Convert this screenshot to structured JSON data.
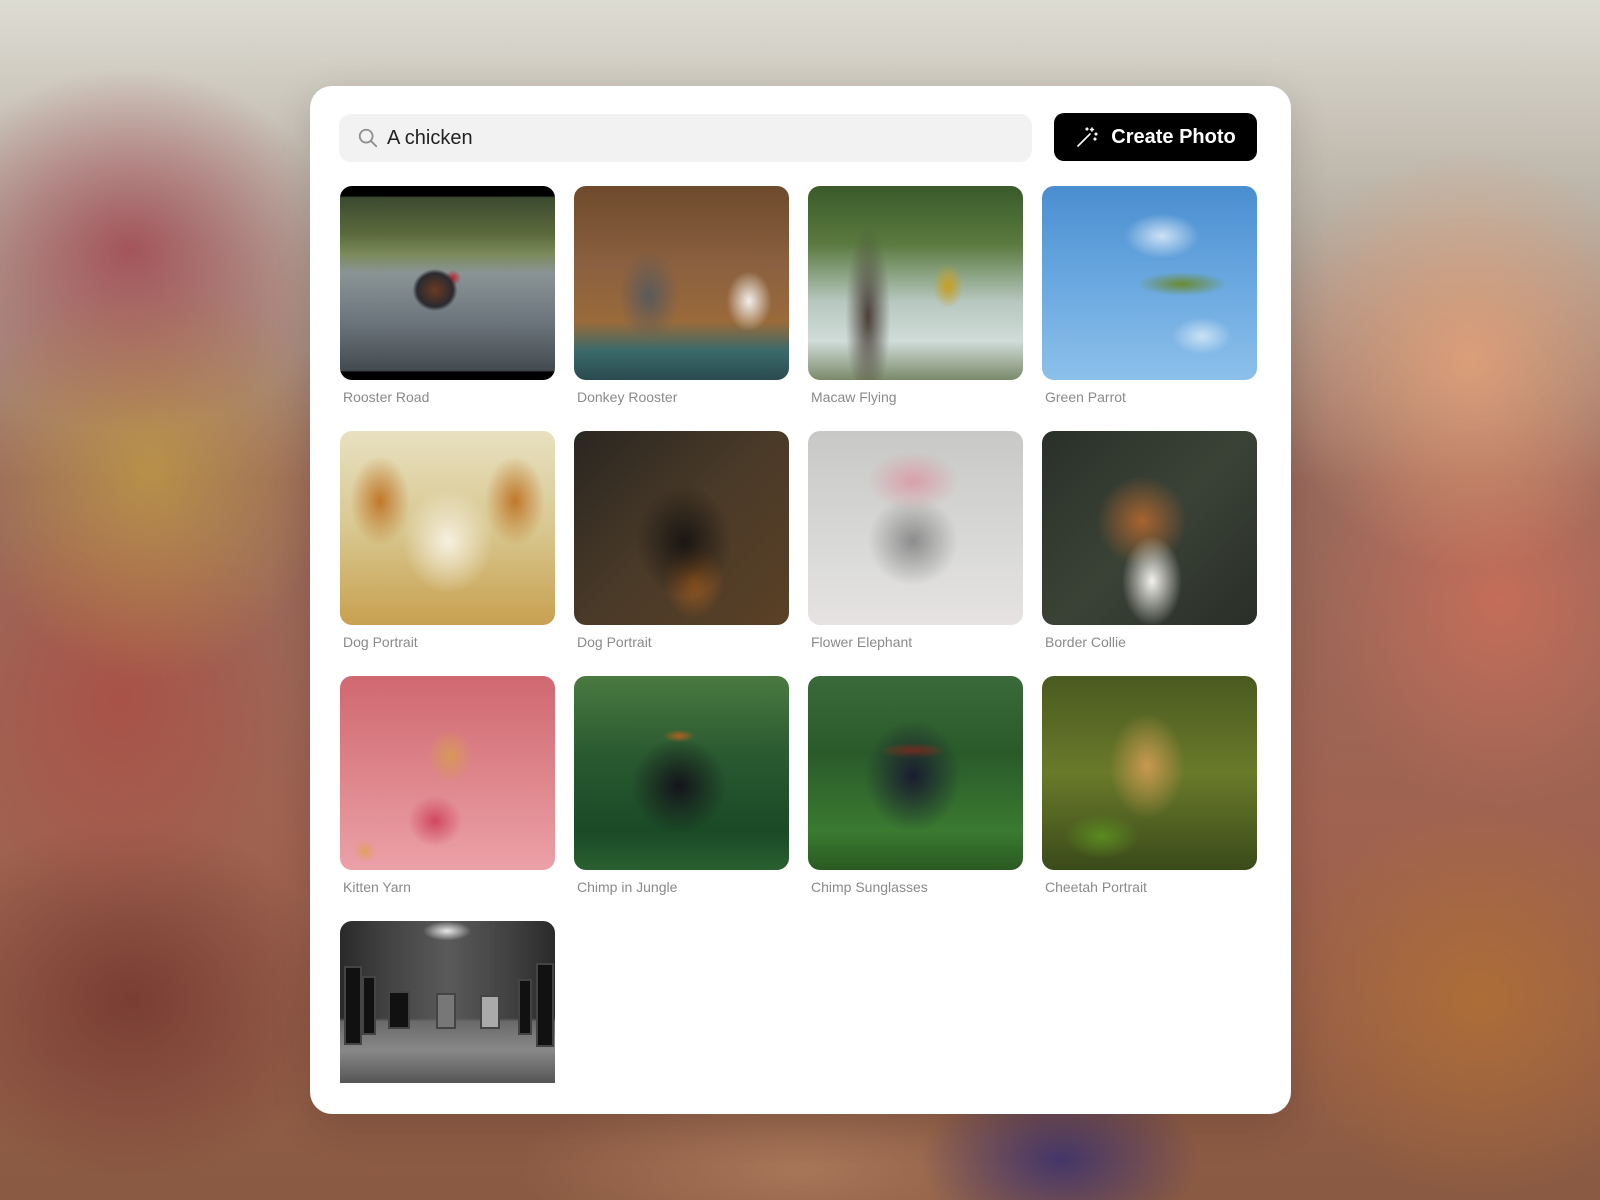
{
  "search": {
    "value": "A chicken",
    "icon": "search-icon"
  },
  "toolbar": {
    "create_label": "Create Photo",
    "create_icon": "magic-wand-icon",
    "create_bg": "#000000"
  },
  "gallery": {
    "items": [
      {
        "label": "Rooster Road",
        "image": "rooster crossing a wet forest road"
      },
      {
        "label": "Donkey Rooster",
        "image": "donkey and white rooster on a boat by a cabin"
      },
      {
        "label": "Macaw Flying",
        "image": "macaw flying by a large tree"
      },
      {
        "label": "Green Parrot",
        "image": "green parrot flying in blue sky"
      },
      {
        "label": "Dog Portrait",
        "image": "painted portrait of a fluffy dog"
      },
      {
        "label": "Dog Portrait",
        "image": "black and tan dog portrait"
      },
      {
        "label": "Flower Elephant",
        "image": "elephant covered in flowers"
      },
      {
        "label": "Border Collie",
        "image": "brown and white border collie"
      },
      {
        "label": "Kitten Yarn",
        "image": "kitten playing with pink yarn"
      },
      {
        "label": "Chimp in Jungle",
        "image": "chimp with sunglasses in jungle"
      },
      {
        "label": "Chimp Sunglasses",
        "image": "gorilla with red sunglasses"
      },
      {
        "label": "Cheetah Portrait",
        "image": "cheetah in greenery"
      },
      {
        "label": "",
        "image": "black and white art gallery interior"
      }
    ]
  }
}
